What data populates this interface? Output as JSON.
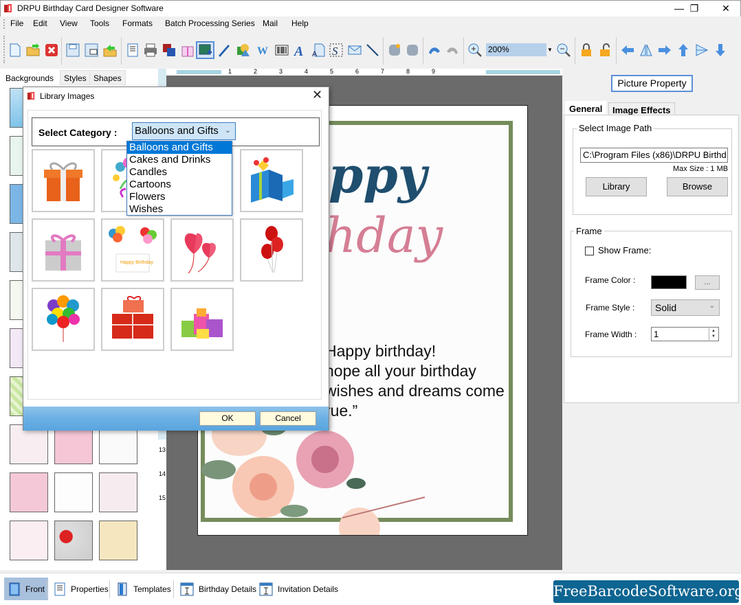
{
  "window": {
    "title": "DRPU Birthday Card Designer Software",
    "minimize_icon": "minimize-icon",
    "restore_icon": "restore-icon",
    "close_icon": "close-icon"
  },
  "menu": [
    "File",
    "Edit",
    "View",
    "Tools",
    "Formats",
    "Batch Processing Series",
    "Mail",
    "Help"
  ],
  "toolbar": {
    "zoom_value": "200%",
    "icons": [
      "new-icon",
      "open-icon",
      "close-doc-icon",
      "save-icon",
      "save-as-icon",
      "export-icon",
      "properties-icon",
      "print-icon",
      "copy-layers-icon",
      "gift-icon",
      "insert-image-icon",
      "pen-icon",
      "shapes-icon",
      "watermark-icon",
      "barcode-icon",
      "text-icon",
      "text-doc-icon",
      "signature-icon",
      "mail-icon",
      "line-icon",
      "database-icon",
      "database-icon-2",
      "undo-icon",
      "redo-icon",
      "zoom-in-icon",
      "zoom-out-icon",
      "lock-icon",
      "unlock-icon",
      "arrow-left-icon",
      "flip-icon",
      "arrow-right-icon",
      "arrow-up-icon",
      "align-icon",
      "arrow-down-icon"
    ]
  },
  "left_panel": {
    "tabs": [
      "Backgrounds",
      "Styles",
      "Shapes"
    ],
    "active_tab": "Backgrounds"
  },
  "ruler": {
    "h_ticks": [
      "1",
      "2",
      "3",
      "4",
      "5",
      "6",
      "7",
      "8",
      "9"
    ],
    "v_ticks": [
      "13",
      "14",
      "15"
    ]
  },
  "card": {
    "title_line1": "ppy",
    "title_line2": "hday",
    "message": [
      "Happy birthday!",
      "hope all your birthday",
      "wishes and dreams come",
      "rue.”"
    ],
    "frame_color": "#758c5b"
  },
  "dialog": {
    "title": "Library Images",
    "category_label": "Select Category :",
    "category_selected": "Balloons and Gifts",
    "category_options": [
      "Balloons and Gifts",
      "Cakes and Drinks",
      "Candles",
      "Cartoons",
      "Flowers",
      "Wishes"
    ],
    "images": [
      "orange-gift-box",
      "balloon-swirl",
      "hidden",
      "blue-gift-box",
      "pink-silver-gift",
      "balloons-happy-birthday-card",
      "heart-balloons",
      "red-balloons",
      "balloon-bunch",
      "red-gift-boxes",
      "colorful-gift-stack"
    ],
    "ok_label": "OK",
    "cancel_label": "Cancel"
  },
  "right_panel": {
    "header": "Picture Property",
    "tabs": [
      "General",
      "Image Effects"
    ],
    "active_tab": "General",
    "image_path": {
      "group_label": "Select Image Path",
      "value": "C:\\Program Files (x86)\\DRPU Birthd",
      "max_size": "Max Size : 1 MB",
      "library_label": "Library",
      "browse_label": "Browse"
    },
    "frame": {
      "group_label": "Frame",
      "show_frame_label": "Show Frame:",
      "show_frame_checked": false,
      "color_label": "Frame Color :",
      "color_value": "#000000",
      "color_button": "...",
      "style_label": "Frame Style :",
      "style_value": "Solid",
      "width_label": "Frame Width :",
      "width_value": "1"
    }
  },
  "bottom_tabs": [
    {
      "label": "Front",
      "icon": "front-page-icon",
      "active": true
    },
    {
      "label": "Properties",
      "icon": "properties-icon",
      "active": false
    },
    {
      "label": "Templates",
      "icon": "templates-icon",
      "active": false
    },
    {
      "label": "Birthday Details",
      "icon": "details-icon",
      "active": false
    },
    {
      "label": "Invitation Details",
      "icon": "details-icon",
      "active": false
    }
  ],
  "brand": "FreeBarcodeSoftware.org"
}
